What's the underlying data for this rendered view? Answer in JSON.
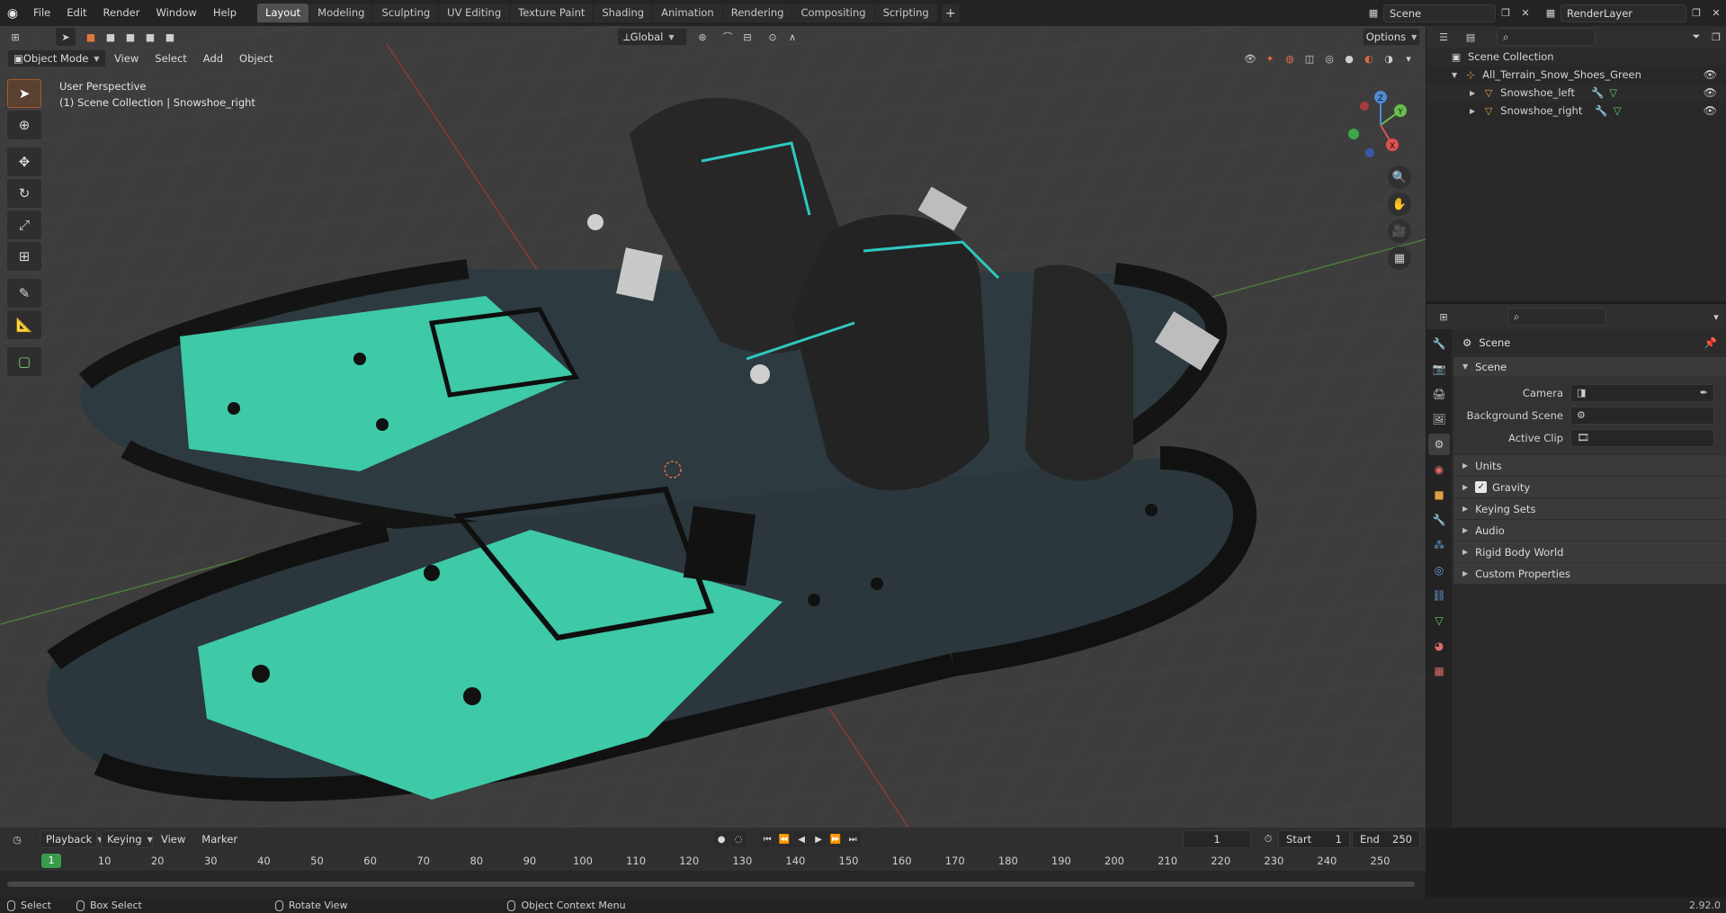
{
  "topbar": {
    "menus": [
      "File",
      "Edit",
      "Render",
      "Window",
      "Help"
    ],
    "workspaces": [
      {
        "label": "Layout",
        "active": true
      },
      {
        "label": "Modeling"
      },
      {
        "label": "Sculpting"
      },
      {
        "label": "UV Editing"
      },
      {
        "label": "Texture Paint"
      },
      {
        "label": "Shading"
      },
      {
        "label": "Animation"
      },
      {
        "label": "Rendering"
      },
      {
        "label": "Compositing"
      },
      {
        "label": "Scripting"
      }
    ],
    "add_label": "+",
    "scene_name": "Scene",
    "render_layer": "RenderLayer"
  },
  "viewport": {
    "mode": "Object Mode",
    "menus": [
      "View",
      "Select",
      "Add",
      "Object"
    ],
    "transform_orientation": "Global",
    "options_label": "Options",
    "info_line1": "User Perspective",
    "info_line2": "(1) Scene Collection | Snowshoe_right",
    "gizmo": {
      "x": "X",
      "y": "Y",
      "z": "Z"
    }
  },
  "outliner": {
    "rows": [
      {
        "label": "Scene Collection",
        "indent": 0,
        "icon": "collection-icon"
      },
      {
        "label": "All_Terrain_Snow_Shoes_Green",
        "indent": 1,
        "icon": "empty-icon"
      },
      {
        "label": "Snowshoe_left",
        "indent": 2,
        "icon": "mesh-icon"
      },
      {
        "label": "Snowshoe_right",
        "indent": 2,
        "icon": "mesh-icon"
      }
    ]
  },
  "properties": {
    "title": "Scene",
    "panel_title": "Scene",
    "fields": [
      {
        "label": "Camera"
      },
      {
        "label": "Background Scene"
      },
      {
        "label": "Active Clip"
      }
    ],
    "subpanels": [
      "Units",
      "Gravity",
      "Keying Sets",
      "Audio",
      "Rigid Body World",
      "Custom Properties"
    ]
  },
  "timeline": {
    "menus": [
      "Playback",
      "Keying",
      "View",
      "Marker"
    ],
    "current_frame": "1",
    "start_label": "Start",
    "start_value": "1",
    "end_label": "End",
    "end_value": "250",
    "ticks": [
      "10",
      "20",
      "30",
      "40",
      "50",
      "60",
      "70",
      "80",
      "90",
      "100",
      "110",
      "120",
      "130",
      "140",
      "150",
      "160",
      "170",
      "180",
      "190",
      "200",
      "210",
      "220",
      "230",
      "240",
      "250"
    ]
  },
  "statusbar": {
    "select": "Select",
    "box_select": "Box Select",
    "rotate_view": "Rotate View",
    "context_menu": "Object Context Menu",
    "version": "2.92.0"
  }
}
